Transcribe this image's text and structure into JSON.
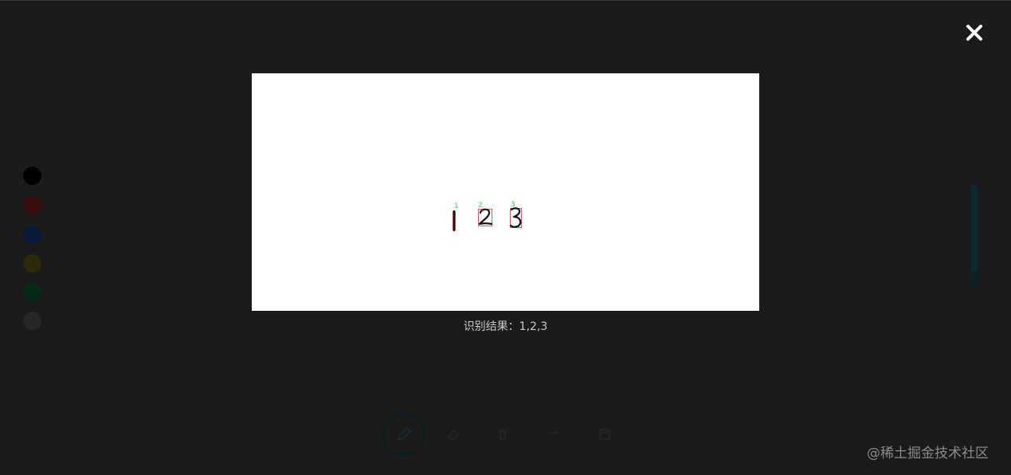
{
  "app": {
    "palette": {
      "colors": [
        "#000000",
        "#3a0d0d",
        "#0a1a3d",
        "#2a2a08",
        "#062a18",
        "#262626"
      ]
    },
    "brush_size_slider": {
      "color": "#0b2a33"
    },
    "toolbar": {
      "tools": [
        {
          "icon": "pen-icon",
          "active": true
        },
        {
          "icon": "eraser-icon",
          "active": false
        },
        {
          "icon": "trash-icon",
          "active": false
        },
        {
          "icon": "line-icon",
          "active": false
        },
        {
          "icon": "save-icon",
          "active": false
        }
      ]
    }
  },
  "modal": {
    "close_icon": "close-icon",
    "recognition": {
      "digits": [
        {
          "index": "1",
          "value": "1"
        },
        {
          "index": "2",
          "value": "2"
        },
        {
          "index": "3",
          "value": "3"
        }
      ],
      "box_color": "#e05555",
      "index_color": "#33d433"
    },
    "result_text": "识别结果：1,2,3"
  },
  "watermark": "@稀土掘金技术社区"
}
